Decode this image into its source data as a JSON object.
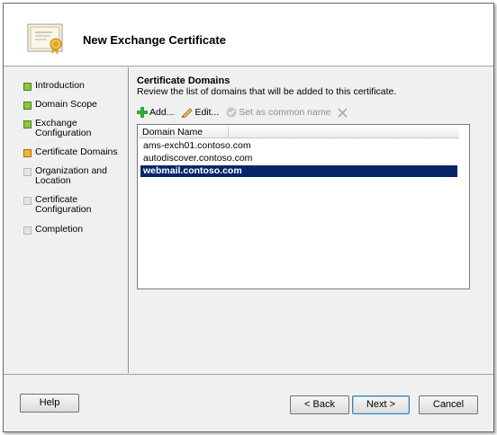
{
  "header": {
    "title": "New Exchange Certificate",
    "icon": "certificate-icon"
  },
  "nav": {
    "items": [
      {
        "label": "Introduction",
        "state": "done"
      },
      {
        "label": "Domain Scope",
        "state": "done"
      },
      {
        "label": "Exchange\nConfiguration",
        "state": "done"
      },
      {
        "label": "Certificate Domains",
        "state": "current"
      },
      {
        "label": "Organization and\nLocation",
        "state": "pending"
      },
      {
        "label": "Certificate\nConfiguration",
        "state": "pending"
      },
      {
        "label": "Completion",
        "state": "pending"
      }
    ]
  },
  "main": {
    "title": "Certificate Domains",
    "description": "Review the list of domains that will be added to this certificate."
  },
  "toolbar": {
    "add_label": "Add...",
    "edit_label": "Edit...",
    "set_common_label": "Set as common name"
  },
  "list": {
    "column_header": "Domain Name",
    "rows": [
      "ams-exch01.contoso.com",
      "autodiscover.contoso.com",
      "webmail.contoso.com"
    ],
    "selected_index": 2
  },
  "footer": {
    "help_label": "Help",
    "back_label": "< Back",
    "next_label": "Next >",
    "cancel_label": "Cancel"
  },
  "colors": {
    "done": "#8cc63f",
    "current": "#f5b335",
    "pending": "#e4e4e4",
    "selection": "#0a246a"
  }
}
